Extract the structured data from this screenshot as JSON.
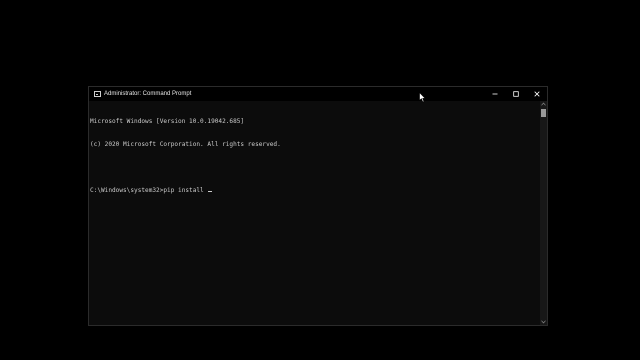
{
  "window": {
    "title": "Administrator: Command Prompt",
    "controls": {
      "minimize_icon": "minimize-icon",
      "maximize_icon": "maximize-icon",
      "close_icon": "close-icon"
    }
  },
  "console": {
    "lines": [
      "Microsoft Windows [Version 10.0.19042.685]",
      "(c) 2020 Microsoft Corporation. All rights reserved.",
      "",
      "C:\\Windows\\system32>pip install "
    ]
  },
  "colors": {
    "background": "#0c0c0c",
    "text": "#cccccc",
    "titlebar": "#000000"
  }
}
